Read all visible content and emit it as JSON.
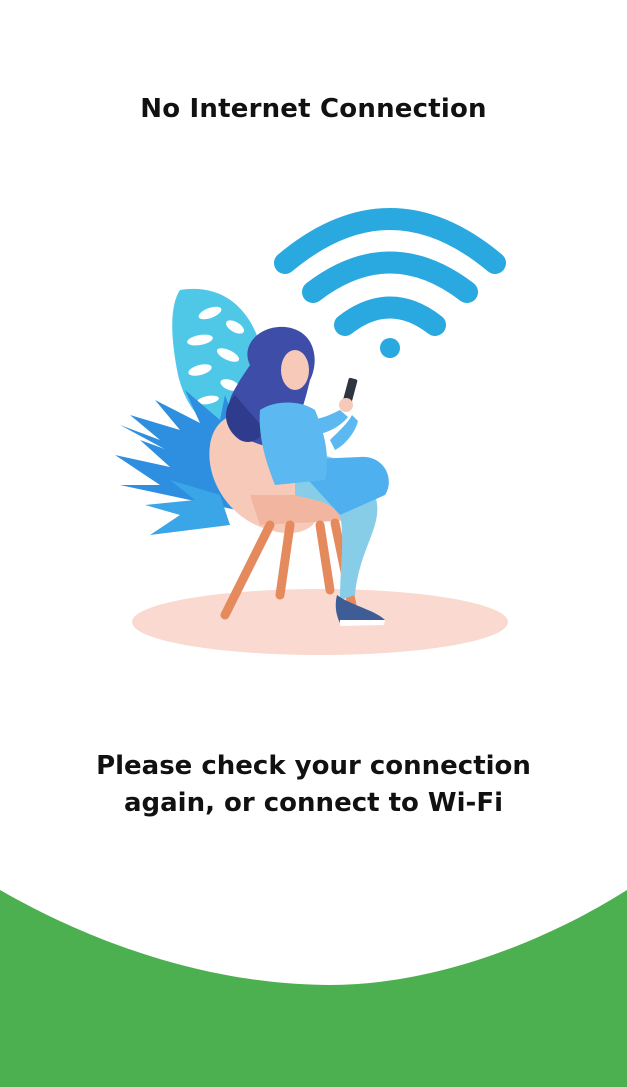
{
  "screen": {
    "title": "No Internet Connection",
    "message_line1": "Please check your connection",
    "message_line2": "again, or connect to Wi-Fi"
  },
  "illustration": {
    "subject": "person-sitting-in-chair-with-phone",
    "icon": "wifi-icon"
  },
  "colors": {
    "wifi": "#2AA8E0",
    "leaf_light": "#4FC8E8",
    "leaf_blue": "#2E8FE0",
    "hair": "#3D4DA8",
    "shirt": "#5CB8F0",
    "pants": "#88CDE8",
    "chair": "#F7C9B9",
    "chair_legs": "#E58A5C",
    "floor_shadow": "#FADAD0",
    "wave": "#4CAF50"
  }
}
